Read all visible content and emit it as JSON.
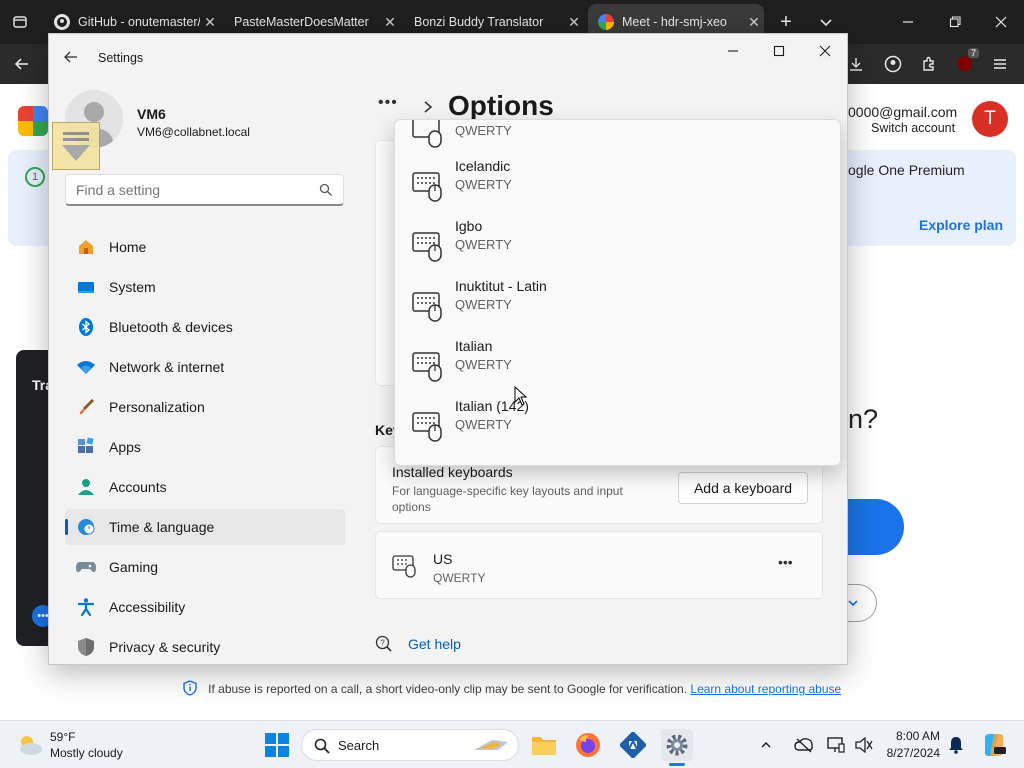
{
  "browser": {
    "tabs": [
      {
        "title": "GitHub - onutemaster/",
        "favicon": "github-icon",
        "active": false
      },
      {
        "title": "PasteMasterDoesMatter",
        "favicon": "",
        "active": false
      },
      {
        "title": "Bonzi Buddy Translator",
        "favicon": "",
        "active": false
      },
      {
        "title": "Meet - hdr-smj-xeo",
        "favicon": "meet-icon",
        "active": true
      }
    ],
    "extensions_badge": "7"
  },
  "google": {
    "email": "0000@gmail.com",
    "switch_account": "Switch account",
    "avatar_letter": "T",
    "banner_text": "ogle One Premium",
    "explore_plan": "Explore plan",
    "dark_card_text": "Tra",
    "question_fragment": "n?",
    "abuse_notice": "If abuse is reported on a call, a short video-only clip may be sent to Google for verification.",
    "abuse_link": "Learn about reporting abuse"
  },
  "settings": {
    "window_title": "Settings",
    "user_name": "VM6",
    "user_email": "VM6@collabnet.local",
    "search_placeholder": "Find a setting",
    "page_title": "Options",
    "breadcrumb_more": "•••",
    "nav": [
      {
        "label": "Home",
        "icon": "home-icon"
      },
      {
        "label": "System",
        "icon": "system-icon"
      },
      {
        "label": "Bluetooth & devices",
        "icon": "bluetooth-icon"
      },
      {
        "label": "Network & internet",
        "icon": "wifi-icon"
      },
      {
        "label": "Personalization",
        "icon": "brush-icon"
      },
      {
        "label": "Apps",
        "icon": "apps-icon"
      },
      {
        "label": "Accounts",
        "icon": "account-icon"
      },
      {
        "label": "Time & language",
        "icon": "globe-clock-icon",
        "active": true
      },
      {
        "label": "Gaming",
        "icon": "gamepad-icon"
      },
      {
        "label": "Accessibility",
        "icon": "accessibility-icon"
      },
      {
        "label": "Privacy & security",
        "icon": "shield-icon"
      }
    ],
    "section_label_fragment": "Key",
    "installed_keyboards": {
      "title": "Installed keyboards",
      "description": "For language-specific key layouts and input options",
      "add_button": "Add a keyboard"
    },
    "installed_list": [
      {
        "name": "US",
        "layout": "QWERTY"
      }
    ],
    "get_help": "Get help",
    "dropdown": {
      "partial_top": "QWERTY",
      "items": [
        {
          "name": "Icelandic",
          "layout": "QWERTY"
        },
        {
          "name": "Igbo",
          "layout": "QWERTY"
        },
        {
          "name": "Inuktitut - Latin",
          "layout": "QWERTY"
        },
        {
          "name": "Italian",
          "layout": "QWERTY"
        },
        {
          "name": "Italian (142)",
          "layout": "QWERTY"
        }
      ]
    }
  },
  "taskbar": {
    "weather_temp": "59°F",
    "weather_desc": "Mostly cloudy",
    "search_label": "Search",
    "time": "8:00 AM",
    "date": "8/27/2024"
  }
}
